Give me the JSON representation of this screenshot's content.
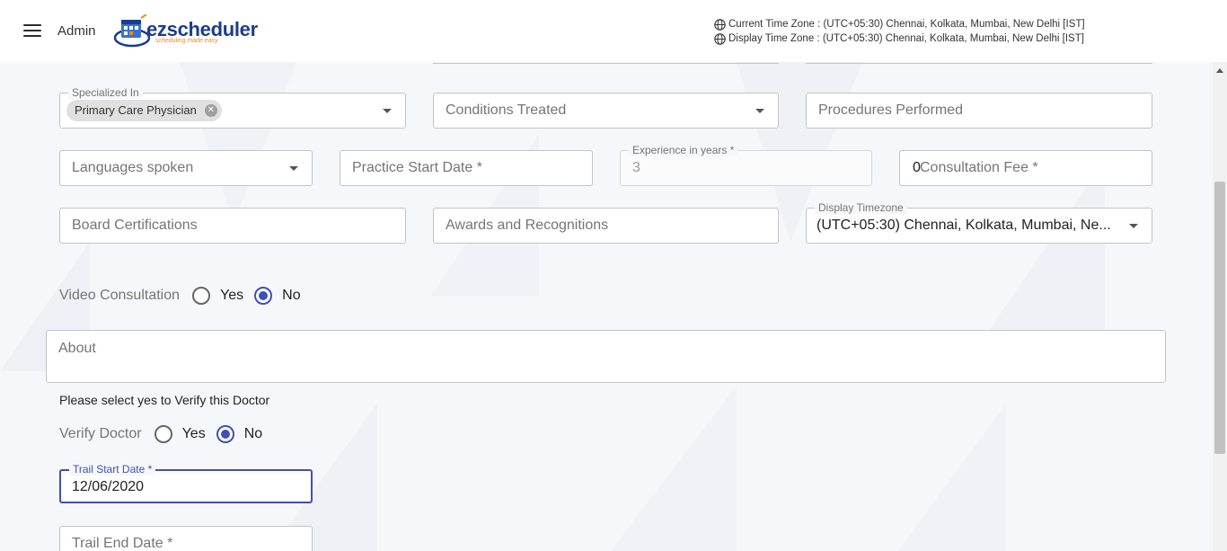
{
  "header": {
    "user_label": "Admin",
    "logo_text_ez": "ez",
    "logo_text_rest": "scheduler",
    "logo_tagline": "scheduling made easy",
    "current_tz": "Current Time Zone : (UTC+05:30) Chennai, Kolkata, Mumbai, New Delhi [IST]",
    "display_tz": "Display Time Zone : (UTC+05:30) Chennai, Kolkata, Mumbai, New Delhi [IST]",
    "icons": {
      "menu": "hamburger-icon",
      "globe": "globe-icon"
    }
  },
  "form": {
    "specialized_in": {
      "label": "Specialized In",
      "chip": "Primary Care Physician"
    },
    "conditions_treated": {
      "placeholder": "Conditions Treated"
    },
    "procedures_performed": {
      "placeholder": "Procedures Performed"
    },
    "languages_spoken": {
      "placeholder": "Languages spoken"
    },
    "practice_start_date": {
      "placeholder": "Practice Start Date *"
    },
    "experience": {
      "label": "Experience in years *",
      "value": "3"
    },
    "consultation_fee": {
      "value": "0",
      "placeholder": "Consultation Fee  *"
    },
    "board_certifications": {
      "placeholder": "Board Certifications"
    },
    "awards": {
      "placeholder": "Awards and Recognitions"
    },
    "display_timezone": {
      "label": "Display Timezone",
      "value": "(UTC+05:30) Chennai, Kolkata, Mumbai, Ne..."
    },
    "video_consultation": {
      "label": "Video Consultation",
      "yes": "Yes",
      "no": "No",
      "selected": "No"
    },
    "about": {
      "placeholder": "About"
    },
    "verify_note": "Please select yes to Verify this Doctor",
    "verify_doctor": {
      "label": "Verify Doctor",
      "yes": "Yes",
      "no": "No",
      "selected": "No"
    },
    "trail_start_date": {
      "label": "Trail Start Date *",
      "value": "12/06/2020"
    },
    "trail_end_date": {
      "placeholder": "Trail End Date *"
    }
  },
  "colors": {
    "accent": "#3f51b5",
    "brand_blue": "#1b3d8f",
    "brand_orange": "#f08a1c",
    "background": "#f6f7fa"
  }
}
